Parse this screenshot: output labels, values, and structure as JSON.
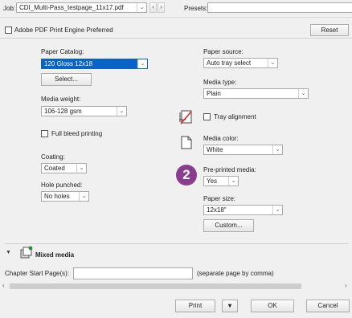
{
  "toolbar": {
    "job_label": "Job:",
    "job_value": "CDI_Multi-Pass_testpage_11x17.pdf",
    "presets_label": "Presets:",
    "presets_value": ""
  },
  "options": {
    "adobe_pdf_label": "Adobe PDF Print Engine Preferred",
    "reset_label": "Reset"
  },
  "left": {
    "paper_catalog_label": "Paper Catalog:",
    "paper_catalog_value": "120 Gloss 12x18",
    "select_button": "Select...",
    "media_weight_label": "Media weight:",
    "media_weight_value": "106-128 gsm",
    "full_bleed_label": "Full bleed printing",
    "coating_label": "Coating:",
    "coating_value": "Coated",
    "hole_punched_label": "Hole punched:",
    "hole_punched_value": "No holes"
  },
  "right": {
    "paper_source_label": "Paper source:",
    "paper_source_value": "Auto tray select",
    "media_type_label": "Media type:",
    "media_type_value": "Plain",
    "tray_alignment_label": "Tray alignment",
    "media_color_label": "Media color:",
    "media_color_value": "White",
    "preprinted_label": "Pre-printed media:",
    "preprinted_value": "Yes",
    "paper_size_label": "Paper size:",
    "paper_size_value": "12x18\"",
    "custom_button": "Custom..."
  },
  "badge": {
    "number": "2",
    "color": "#8a3d8f"
  },
  "mixed_media": {
    "title": "Mixed media",
    "chapter_label": "Chapter Start Page(s):",
    "chapter_value": "",
    "chapter_hint": "(separate page by comma)"
  },
  "footer": {
    "print_label": "Print",
    "print_menu_glyph": "▾",
    "ok_label": "OK",
    "cancel_label": "Cancel"
  },
  "colors": {
    "accent": "#0a64c8",
    "badge": "#8a3d8f"
  }
}
